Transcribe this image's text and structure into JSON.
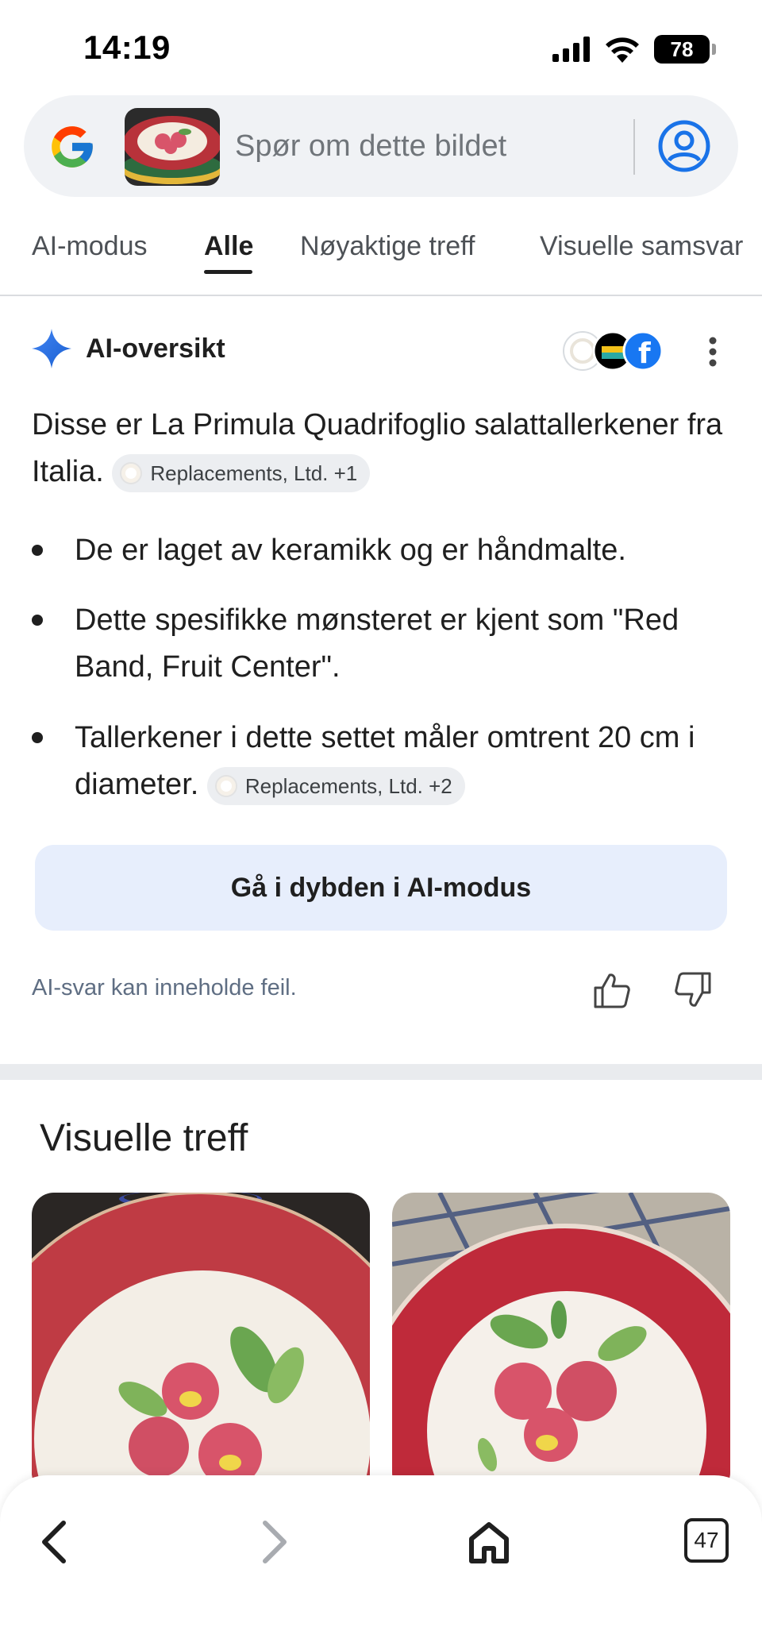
{
  "status_bar": {
    "time": "14:19",
    "battery": "78"
  },
  "search": {
    "placeholder": "Spør om dette bildet"
  },
  "tabs": [
    {
      "label": "AI-modus"
    },
    {
      "label": "Alle"
    },
    {
      "label": "Nøyaktige treff"
    },
    {
      "label": "Visuelle samsvar"
    }
  ],
  "active_tab": "Alle",
  "ai_overview": {
    "title": "AI-oversikt",
    "intro": "Disse er La Primula Quadrifoglio salattallerkener fra Italia.",
    "intro_chip": "Replacements, Ltd. +1",
    "bullets": [
      {
        "text": "De er laget av keramikk og er håndmalte."
      },
      {
        "text": "Dette spesifikke mønsteret er kjent som \"Red Band, Fruit Center\"."
      },
      {
        "text": "Tallerkener i dette settet måler omtrent 20 cm i diameter.",
        "chip": "Replacements, Ltd. +2"
      }
    ],
    "deep_dive_button": "Gå i dybden i AI-modus",
    "disclaimer": "AI-svar kan inneholde feil."
  },
  "visual_matches": {
    "title": "Visuelle treff"
  },
  "bottom_nav": {
    "tab_count": "47"
  },
  "colors": {
    "accent_blue": "#1a73e8",
    "ai_button_bg": "#e7eefc",
    "plate_red": "#b8323a"
  }
}
